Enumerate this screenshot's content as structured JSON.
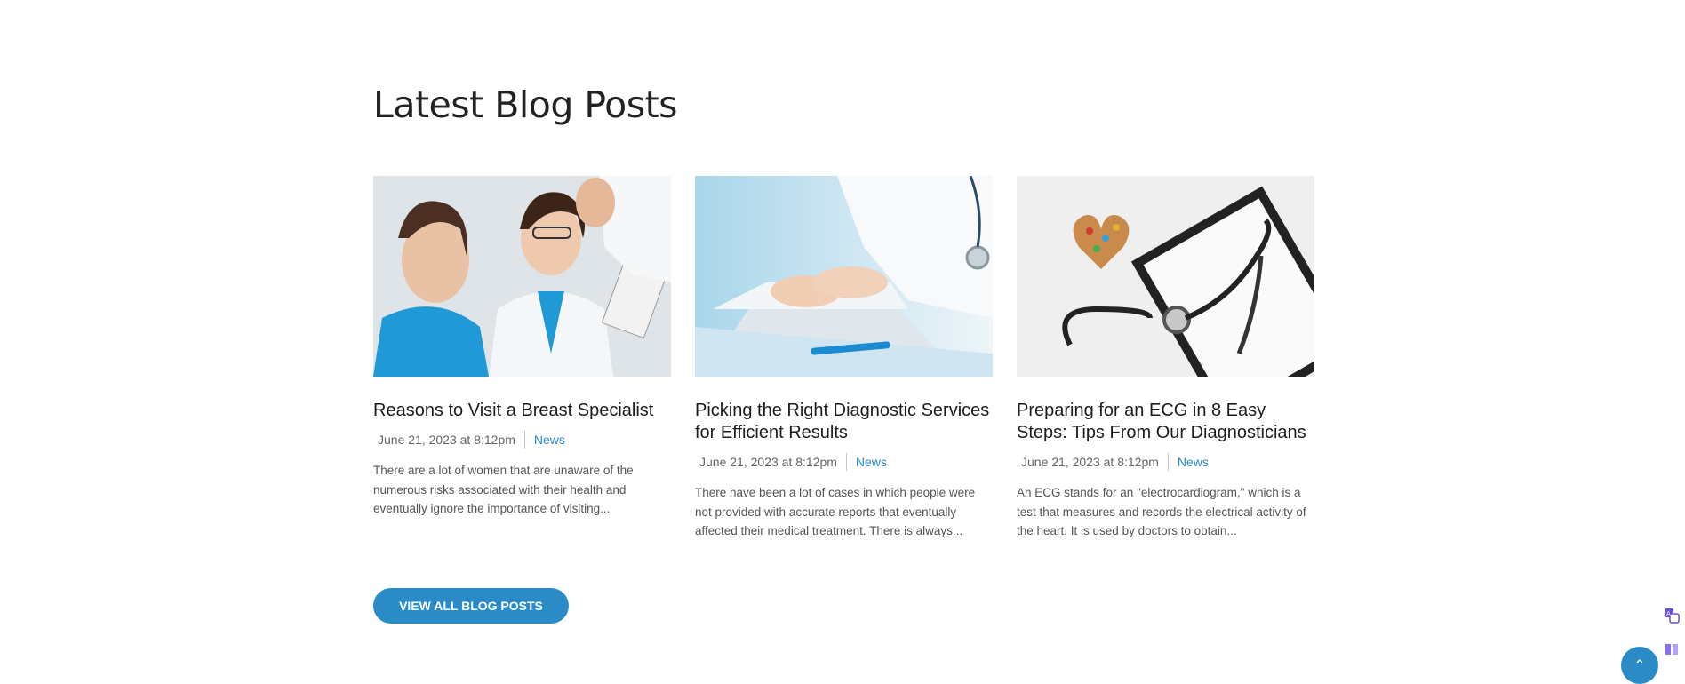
{
  "section": {
    "title": "Latest Blog Posts"
  },
  "posts": [
    {
      "image": "doctors-smiling-photo",
      "title": "Reasons to Visit a Breast Specialist",
      "date": "June 21, 2023 at 8:12pm",
      "category": "News",
      "excerpt": "There are a lot of women that are unaware of the numerous risks associated with their health and eventually ignore the importance of visiting..."
    },
    {
      "image": "hands-typing-laptop-photo",
      "title": "Picking the Right Diagnostic Services for Efficient Results",
      "date": "June 21, 2023 at 8:12pm",
      "category": "News",
      "excerpt": "There have been a lot of cases in which people were not provided with accurate reports that eventually affected their medical treatment. There is always..."
    },
    {
      "image": "stethoscope-ecg-clipboard-photo",
      "title": "Preparing for an ECG in 8 Easy Steps: Tips From Our Diagnosticians",
      "date": "June 21, 2023 at 8:12pm",
      "category": "News",
      "excerpt": "An ECG stands for an \"electrocardiogram,\" which is a test that measures and records the electrical activity of the heart. It is used by doctors to obtain..."
    }
  ],
  "cta": {
    "label": "VIEW ALL BLOG POSTS"
  },
  "floating": {
    "translate_icon": "translate-icon",
    "reader_icon": "book-icon",
    "scroll_top_icon": "chevron-up-icon"
  },
  "colors": {
    "accent": "#2a8bc7",
    "text": "#222222"
  }
}
